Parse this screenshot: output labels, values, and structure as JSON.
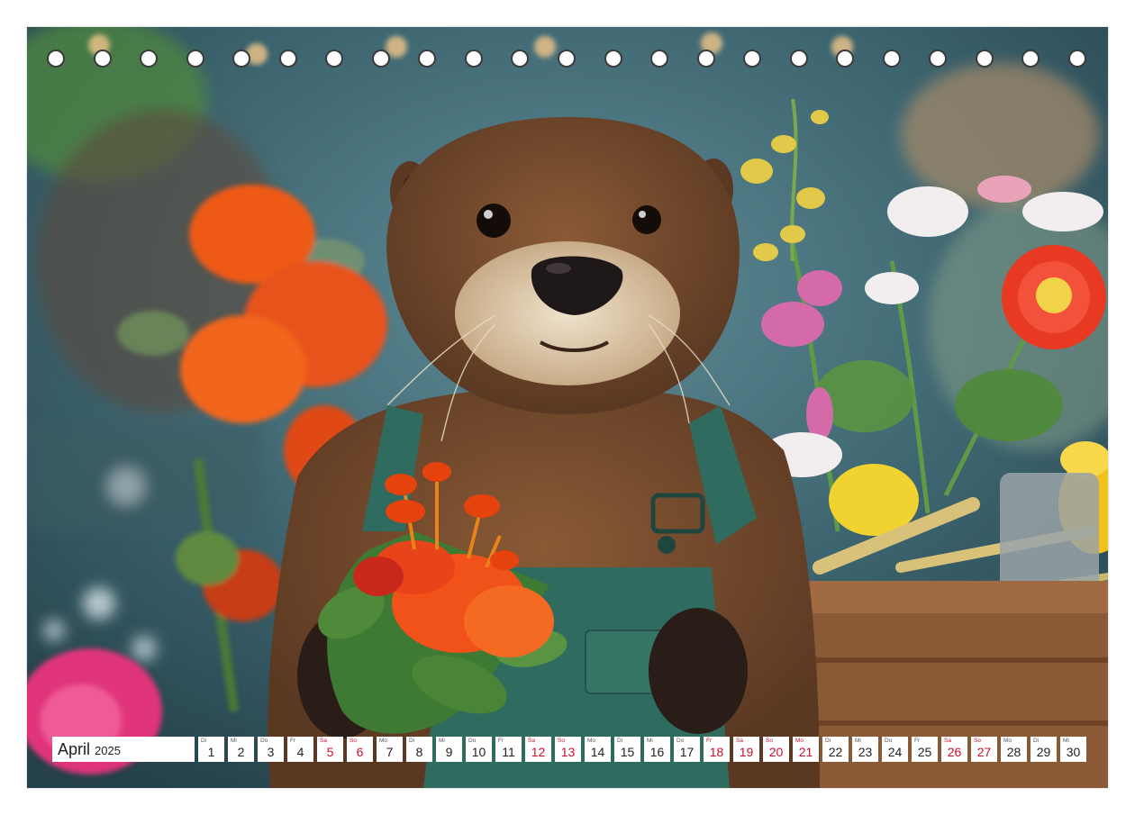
{
  "calendar": {
    "month": "April",
    "year": "2025",
    "days": [
      {
        "wd": "Di",
        "num": "1",
        "weekend": false
      },
      {
        "wd": "Mi",
        "num": "2",
        "weekend": false
      },
      {
        "wd": "Do",
        "num": "3",
        "weekend": false
      },
      {
        "wd": "Fr",
        "num": "4",
        "weekend": false
      },
      {
        "wd": "Sa",
        "num": "5",
        "weekend": true
      },
      {
        "wd": "So",
        "num": "6",
        "weekend": true
      },
      {
        "wd": "Mo",
        "num": "7",
        "weekend": false
      },
      {
        "wd": "Di",
        "num": "8",
        "weekend": false
      },
      {
        "wd": "Mi",
        "num": "9",
        "weekend": false
      },
      {
        "wd": "Do",
        "num": "10",
        "weekend": false
      },
      {
        "wd": "Fr",
        "num": "11",
        "weekend": false
      },
      {
        "wd": "Sa",
        "num": "12",
        "weekend": true
      },
      {
        "wd": "So",
        "num": "13",
        "weekend": true
      },
      {
        "wd": "Mo",
        "num": "14",
        "weekend": false
      },
      {
        "wd": "Di",
        "num": "15",
        "weekend": false
      },
      {
        "wd": "Mi",
        "num": "16",
        "weekend": false
      },
      {
        "wd": "Do",
        "num": "17",
        "weekend": false
      },
      {
        "wd": "Fr",
        "num": "18",
        "weekend": true
      },
      {
        "wd": "Sa",
        "num": "19",
        "weekend": true
      },
      {
        "wd": "So",
        "num": "20",
        "weekend": true
      },
      {
        "wd": "Mo",
        "num": "21",
        "weekend": true
      },
      {
        "wd": "Di",
        "num": "22",
        "weekend": false
      },
      {
        "wd": "Mi",
        "num": "23",
        "weekend": false
      },
      {
        "wd": "Do",
        "num": "24",
        "weekend": false
      },
      {
        "wd": "Fr",
        "num": "25",
        "weekend": false
      },
      {
        "wd": "Sa",
        "num": "26",
        "weekend": true
      },
      {
        "wd": "So",
        "num": "27",
        "weekend": true
      },
      {
        "wd": "Mo",
        "num": "28",
        "weekend": false
      },
      {
        "wd": "Di",
        "num": "29",
        "weekend": false
      },
      {
        "wd": "Mi",
        "num": "30",
        "weekend": false
      }
    ]
  },
  "binding_holes": 23,
  "colors": {
    "holiday": "#c8102e",
    "otter_fur": "#7a4a2a",
    "overalls": "#2f6b5e",
    "flowers": "#f0521a"
  }
}
